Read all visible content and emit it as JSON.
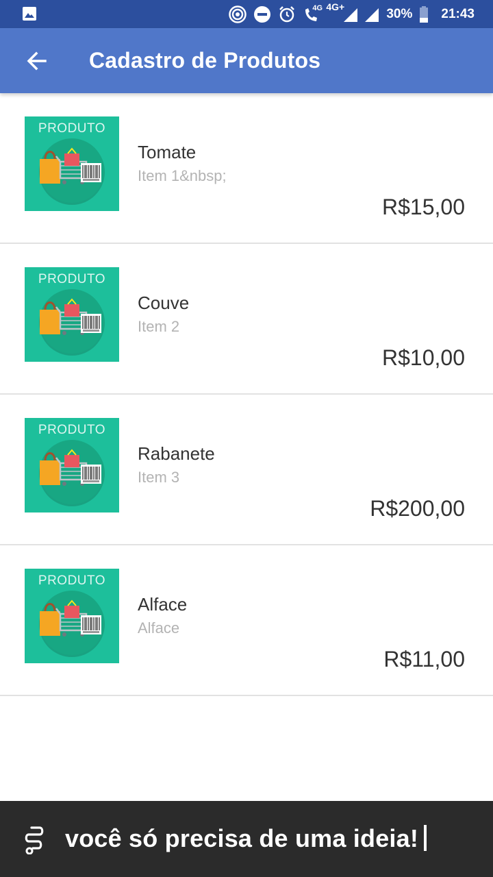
{
  "status_bar": {
    "network_4g": "4G",
    "network_4g_plus": "4G+",
    "battery": "30%",
    "time": "21:43"
  },
  "app_bar": {
    "title": "Cadastro de Produtos"
  },
  "products": [
    {
      "thumb_label": "PRODUTO",
      "name": "Tomate",
      "description": "Item 1&nbsp;",
      "price": "R$15,00"
    },
    {
      "thumb_label": "PRODUTO",
      "name": "Couve",
      "description": "Item 2",
      "price": "R$10,00"
    },
    {
      "thumb_label": "PRODUTO",
      "name": "Rabanete",
      "description": "Item 3",
      "price": "R$200,00"
    },
    {
      "thumb_label": "PRODUTO",
      "name": "Alface",
      "description": "Alface",
      "price": "R$11,00"
    }
  ],
  "banner": {
    "text": "você só precisa de uma ideia!"
  },
  "colors": {
    "status_bar": "#2c4f9e",
    "app_bar": "#5077c9",
    "thumb_bg": "#1dbf9b",
    "banner_bg": "#2b2b2b"
  }
}
